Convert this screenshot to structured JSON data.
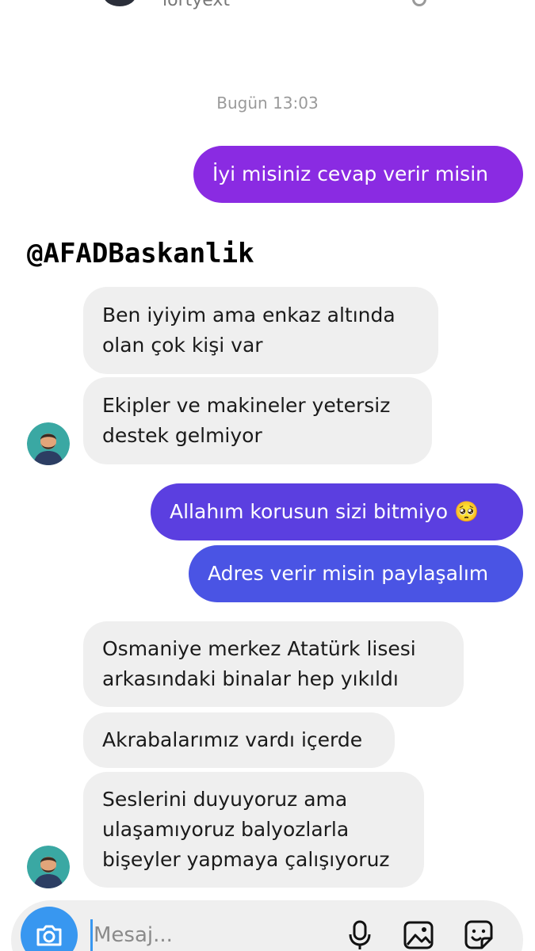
{
  "header": {
    "handle": "lortyext"
  },
  "conversation": {
    "timestamp": "Bugün 13:03"
  },
  "overlay_caption": "@AFADBaskanlik",
  "messages": [
    {
      "direction": "sent",
      "text": "İyi misiniz cevap verir misin",
      "color": "#8a2be2"
    },
    {
      "direction": "received",
      "text": "Ben iyiyim ama enkaz altında\nolan çok kişi var"
    },
    {
      "direction": "received",
      "text": "Ekipler ve makineler yetersiz\ndestek gelmiyor"
    },
    {
      "direction": "sent",
      "text": "Allahım korusun sizi bitmiyo 🥺",
      "color": "#5b3fe0"
    },
    {
      "direction": "sent",
      "text": "Adres verir misin paylaşalım",
      "color": "#4a54e4"
    },
    {
      "direction": "received",
      "text": "Osmaniye merkez Atatürk lisesi\narkasındaki binalar hep yıkıldı"
    },
    {
      "direction": "received",
      "text": "Akrabalarımız vardı içerde"
    },
    {
      "direction": "received",
      "text": "Seslerini duyuyoruz ama\nulaşamıyoruz balyozlarla\nbişeyler yapmaya çalışıyoruz"
    }
  ],
  "composer": {
    "placeholder": "Mesaj...",
    "accent": "#3897f0",
    "icons": [
      "camera-icon",
      "microphone-icon",
      "gallery-icon",
      "sticker-icon"
    ]
  }
}
